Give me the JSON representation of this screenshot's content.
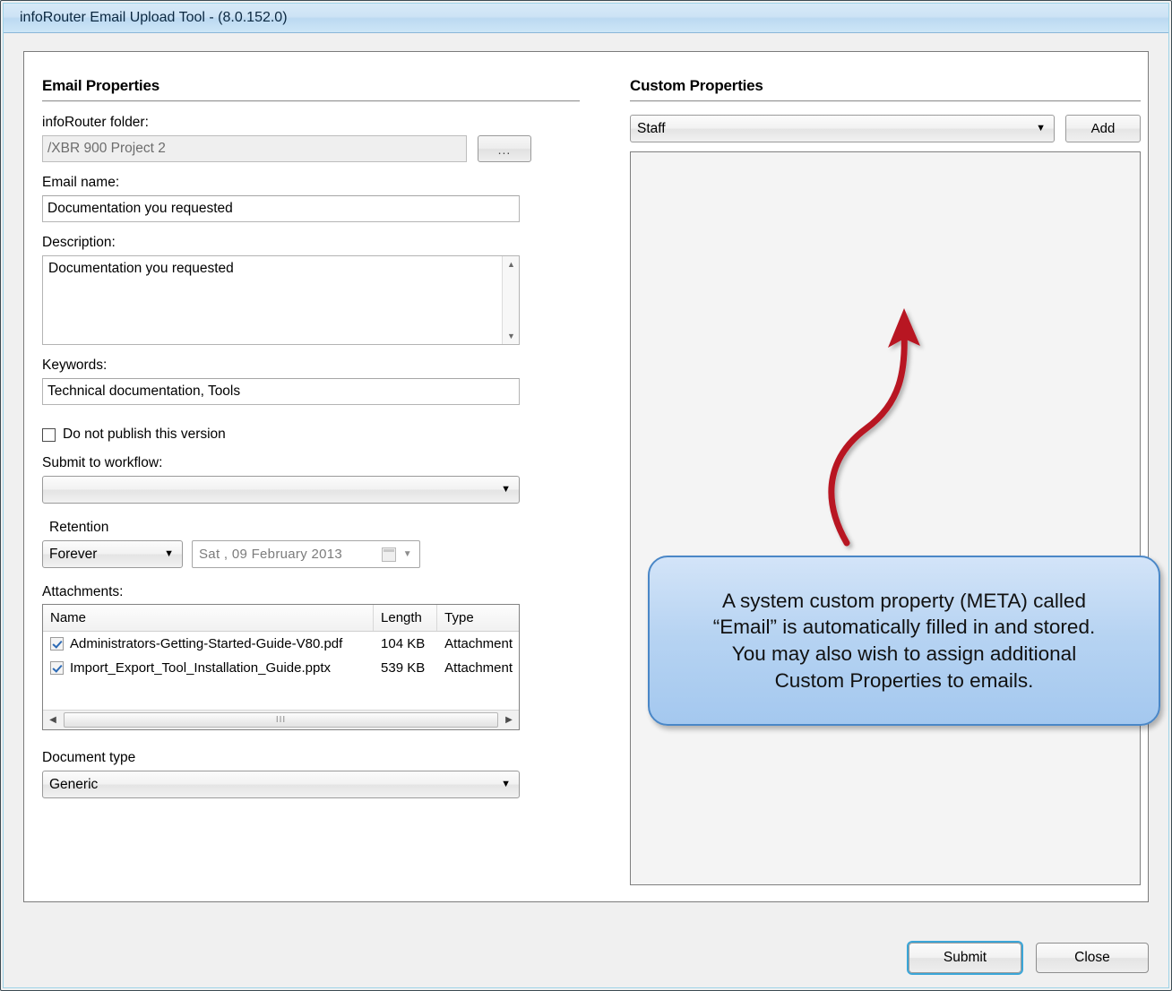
{
  "window": {
    "title": "infoRouter Email Upload Tool - (8.0.152.0)"
  },
  "email_properties": {
    "section_title": "Email Properties",
    "folder": {
      "label": "infoRouter folder:",
      "value": "/XBR 900 Project 2",
      "browse_label": "..."
    },
    "email_name": {
      "label": "Email name:",
      "value": "Documentation you requested"
    },
    "description": {
      "label": "Description:",
      "value": "Documentation you requested",
      "scroll_up": "▲",
      "scroll_down": "▼"
    },
    "keywords": {
      "label": "Keywords:",
      "value": "Technical documentation, Tools"
    },
    "do_not_publish": {
      "label": "Do not publish this version",
      "checked": false
    },
    "workflow": {
      "label": "Submit to workflow:",
      "value": "",
      "arrow": "▼"
    },
    "retention": {
      "label": "Retention",
      "value": "Forever",
      "arrow": "▼",
      "date_value": "Sat , 09  February  2013",
      "date_arrow": "▼"
    },
    "attachments": {
      "label": "Attachments:",
      "columns": [
        "Name",
        "Length",
        "Type"
      ],
      "rows": [
        {
          "checked": true,
          "name": "Administrators-Getting-Started-Guide-V80.pdf",
          "length": "104 KB",
          "type": "Attachment"
        },
        {
          "checked": true,
          "name": "Import_Export_Tool_Installation_Guide.pptx",
          "length": "539 KB",
          "type": "Attachment"
        }
      ],
      "scroll_left": "◀",
      "scroll_right": "▶",
      "thumb_grip": "III"
    },
    "document_type": {
      "label": "Document type",
      "value": "Generic",
      "arrow": "▼"
    }
  },
  "custom_properties": {
    "section_title": "Custom Properties",
    "selector_value": "Staff",
    "selector_arrow": "▼",
    "add_label": "Add"
  },
  "annotation": {
    "callout_text": "A system custom property (META) called\n“Email” is automatically filled in and stored.\nYou may also wish to assign additional\nCustom Properties to emails.",
    "arrow_color": "#b81423",
    "callout_border_color": "#4a87c7"
  },
  "footer": {
    "submit_label": "Submit",
    "close_label": "Close"
  }
}
